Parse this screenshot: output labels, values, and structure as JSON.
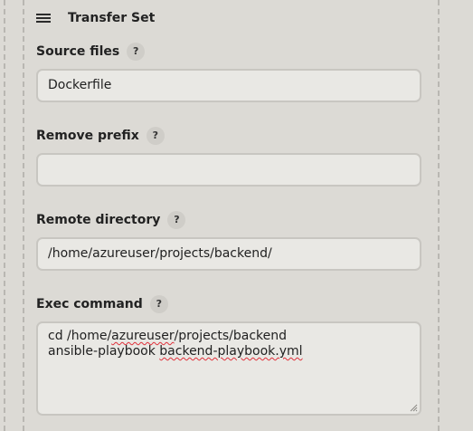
{
  "transfer_set": {
    "title": "Transfer Set",
    "source_files": {
      "label": "Source files",
      "help": "?",
      "value": "Dockerfile"
    },
    "remove_prefix": {
      "label": "Remove prefix",
      "help": "?",
      "value": ""
    },
    "remote_directory": {
      "label": "Remote directory",
      "help": "?",
      "value": "/home/azureuser/projects/backend/"
    },
    "exec_command": {
      "label": "Exec command",
      "help": "?",
      "line1_prefix": "cd /home/",
      "line1_word": "azureuser",
      "line1_suffix": "/projects/backend",
      "line2_prefix": "ansible-playbook ",
      "line2_word": "backend-playbook.yml"
    }
  },
  "icons": {
    "drag_handle": "drag-handle-icon",
    "resize": "resize-grip-icon"
  },
  "colors": {
    "background": "#dcdad5",
    "input_background": "#e9e8e4",
    "input_border": "#c8c6c1",
    "spellcheck_underline": "#e0303a"
  }
}
